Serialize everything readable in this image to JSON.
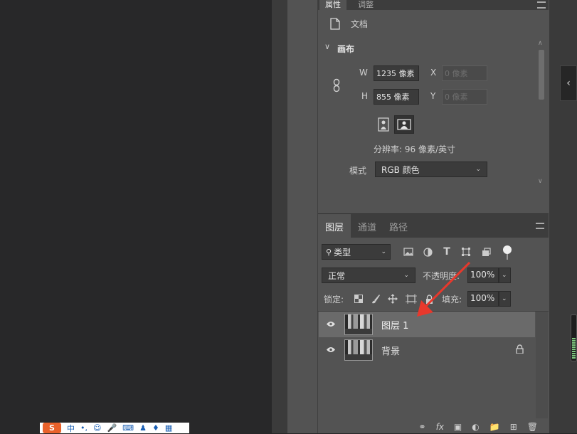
{
  "properties_panel": {
    "tabs": [
      "属性",
      "调整"
    ],
    "doc_label": "文档",
    "canvas_section": "画布",
    "width_label": "W",
    "width_value": "1235 像素",
    "height_label": "H",
    "height_value": "855 像素",
    "x_label": "X",
    "x_placeholder": "0 像素",
    "y_label": "Y",
    "y_placeholder": "0 像素",
    "resolution": "分辨率: 96 像素/英寸",
    "mode_label": "模式",
    "mode_value": "RGB 颜色"
  },
  "layers_panel": {
    "tabs": [
      "图层",
      "通道",
      "路径"
    ],
    "filter_label": "类型",
    "blend_mode": "正常",
    "opacity_label": "不透明度:",
    "opacity_value": "100%",
    "lock_label": "锁定:",
    "fill_label": "填充:",
    "fill_value": "100%",
    "layers": [
      {
        "name": "图层 1",
        "selected": true,
        "locked": false
      },
      {
        "name": "背景",
        "selected": false,
        "locked": true
      }
    ],
    "bottom_fx": "fx"
  },
  "ime_bar": {
    "logo": "S",
    "mode": "中"
  },
  "colors": {
    "panel_bg": "#535353",
    "panel_header_bg": "#3d3d3d",
    "canvas_bg": "#282829",
    "selected_row": "#6a6a6a",
    "annotation_arrow": "#e8382c"
  }
}
